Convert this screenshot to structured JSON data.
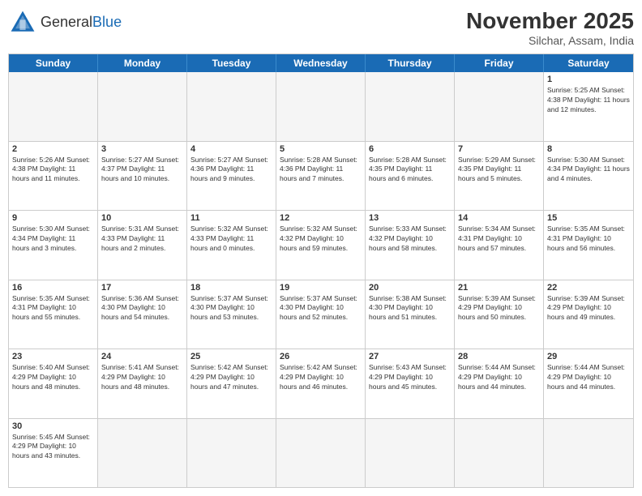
{
  "header": {
    "logo_general": "General",
    "logo_blue": "Blue",
    "month_title": "November 2025",
    "location": "Silchar, Assam, India"
  },
  "days_of_week": [
    "Sunday",
    "Monday",
    "Tuesday",
    "Wednesday",
    "Thursday",
    "Friday",
    "Saturday"
  ],
  "rows": [
    [
      {
        "day": "",
        "empty": true,
        "info": ""
      },
      {
        "day": "",
        "empty": true,
        "info": ""
      },
      {
        "day": "",
        "empty": true,
        "info": ""
      },
      {
        "day": "",
        "empty": true,
        "info": ""
      },
      {
        "day": "",
        "empty": true,
        "info": ""
      },
      {
        "day": "",
        "empty": true,
        "info": ""
      },
      {
        "day": "1",
        "empty": false,
        "info": "Sunrise: 5:25 AM\nSunset: 4:38 PM\nDaylight: 11 hours and 12 minutes."
      }
    ],
    [
      {
        "day": "2",
        "empty": false,
        "info": "Sunrise: 5:26 AM\nSunset: 4:38 PM\nDaylight: 11 hours and 11 minutes."
      },
      {
        "day": "3",
        "empty": false,
        "info": "Sunrise: 5:27 AM\nSunset: 4:37 PM\nDaylight: 11 hours and 10 minutes."
      },
      {
        "day": "4",
        "empty": false,
        "info": "Sunrise: 5:27 AM\nSunset: 4:36 PM\nDaylight: 11 hours and 9 minutes."
      },
      {
        "day": "5",
        "empty": false,
        "info": "Sunrise: 5:28 AM\nSunset: 4:36 PM\nDaylight: 11 hours and 7 minutes."
      },
      {
        "day": "6",
        "empty": false,
        "info": "Sunrise: 5:28 AM\nSunset: 4:35 PM\nDaylight: 11 hours and 6 minutes."
      },
      {
        "day": "7",
        "empty": false,
        "info": "Sunrise: 5:29 AM\nSunset: 4:35 PM\nDaylight: 11 hours and 5 minutes."
      },
      {
        "day": "8",
        "empty": false,
        "info": "Sunrise: 5:30 AM\nSunset: 4:34 PM\nDaylight: 11 hours and 4 minutes."
      }
    ],
    [
      {
        "day": "9",
        "empty": false,
        "info": "Sunrise: 5:30 AM\nSunset: 4:34 PM\nDaylight: 11 hours and 3 minutes."
      },
      {
        "day": "10",
        "empty": false,
        "info": "Sunrise: 5:31 AM\nSunset: 4:33 PM\nDaylight: 11 hours and 2 minutes."
      },
      {
        "day": "11",
        "empty": false,
        "info": "Sunrise: 5:32 AM\nSunset: 4:33 PM\nDaylight: 11 hours and 0 minutes."
      },
      {
        "day": "12",
        "empty": false,
        "info": "Sunrise: 5:32 AM\nSunset: 4:32 PM\nDaylight: 10 hours and 59 minutes."
      },
      {
        "day": "13",
        "empty": false,
        "info": "Sunrise: 5:33 AM\nSunset: 4:32 PM\nDaylight: 10 hours and 58 minutes."
      },
      {
        "day": "14",
        "empty": false,
        "info": "Sunrise: 5:34 AM\nSunset: 4:31 PM\nDaylight: 10 hours and 57 minutes."
      },
      {
        "day": "15",
        "empty": false,
        "info": "Sunrise: 5:35 AM\nSunset: 4:31 PM\nDaylight: 10 hours and 56 minutes."
      }
    ],
    [
      {
        "day": "16",
        "empty": false,
        "info": "Sunrise: 5:35 AM\nSunset: 4:31 PM\nDaylight: 10 hours and 55 minutes."
      },
      {
        "day": "17",
        "empty": false,
        "info": "Sunrise: 5:36 AM\nSunset: 4:30 PM\nDaylight: 10 hours and 54 minutes."
      },
      {
        "day": "18",
        "empty": false,
        "info": "Sunrise: 5:37 AM\nSunset: 4:30 PM\nDaylight: 10 hours and 53 minutes."
      },
      {
        "day": "19",
        "empty": false,
        "info": "Sunrise: 5:37 AM\nSunset: 4:30 PM\nDaylight: 10 hours and 52 minutes."
      },
      {
        "day": "20",
        "empty": false,
        "info": "Sunrise: 5:38 AM\nSunset: 4:30 PM\nDaylight: 10 hours and 51 minutes."
      },
      {
        "day": "21",
        "empty": false,
        "info": "Sunrise: 5:39 AM\nSunset: 4:29 PM\nDaylight: 10 hours and 50 minutes."
      },
      {
        "day": "22",
        "empty": false,
        "info": "Sunrise: 5:39 AM\nSunset: 4:29 PM\nDaylight: 10 hours and 49 minutes."
      }
    ],
    [
      {
        "day": "23",
        "empty": false,
        "info": "Sunrise: 5:40 AM\nSunset: 4:29 PM\nDaylight: 10 hours and 48 minutes."
      },
      {
        "day": "24",
        "empty": false,
        "info": "Sunrise: 5:41 AM\nSunset: 4:29 PM\nDaylight: 10 hours and 48 minutes."
      },
      {
        "day": "25",
        "empty": false,
        "info": "Sunrise: 5:42 AM\nSunset: 4:29 PM\nDaylight: 10 hours and 47 minutes."
      },
      {
        "day": "26",
        "empty": false,
        "info": "Sunrise: 5:42 AM\nSunset: 4:29 PM\nDaylight: 10 hours and 46 minutes."
      },
      {
        "day": "27",
        "empty": false,
        "info": "Sunrise: 5:43 AM\nSunset: 4:29 PM\nDaylight: 10 hours and 45 minutes."
      },
      {
        "day": "28",
        "empty": false,
        "info": "Sunrise: 5:44 AM\nSunset: 4:29 PM\nDaylight: 10 hours and 44 minutes."
      },
      {
        "day": "29",
        "empty": false,
        "info": "Sunrise: 5:44 AM\nSunset: 4:29 PM\nDaylight: 10 hours and 44 minutes."
      }
    ],
    [
      {
        "day": "30",
        "empty": false,
        "info": "Sunrise: 5:45 AM\nSunset: 4:29 PM\nDaylight: 10 hours and 43 minutes."
      },
      {
        "day": "",
        "empty": true,
        "info": ""
      },
      {
        "day": "",
        "empty": true,
        "info": ""
      },
      {
        "day": "",
        "empty": true,
        "info": ""
      },
      {
        "day": "",
        "empty": true,
        "info": ""
      },
      {
        "day": "",
        "empty": true,
        "info": ""
      },
      {
        "day": "",
        "empty": true,
        "info": ""
      }
    ]
  ]
}
